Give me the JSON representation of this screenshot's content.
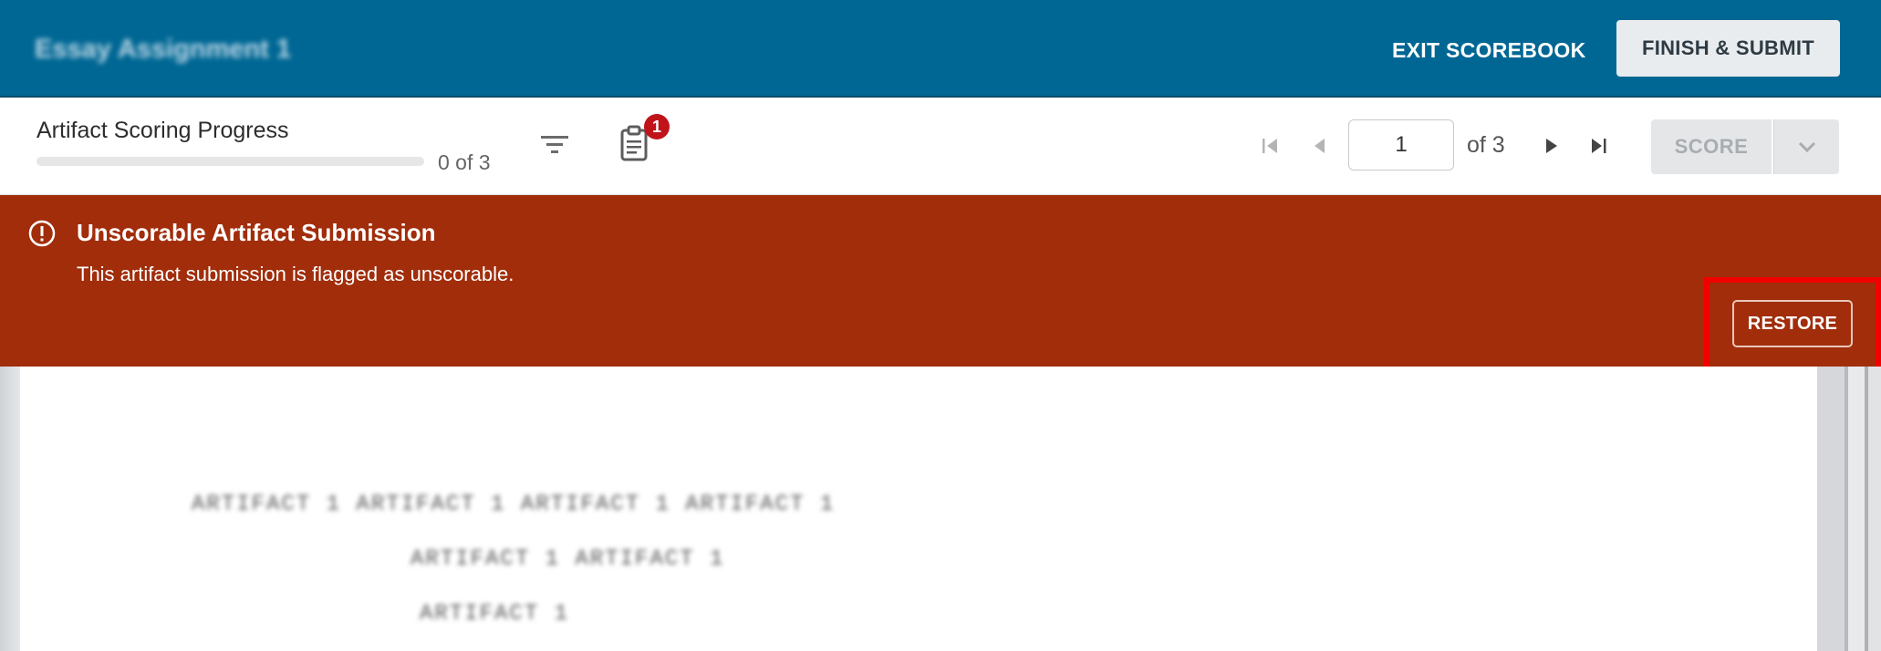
{
  "header": {
    "title": "Essay Assignment 1",
    "exit_label": "EXIT SCOREBOOK",
    "finish_label": "FINISH & SUBMIT"
  },
  "toolbar": {
    "progress_title": "Artifact Scoring Progress",
    "progress_text": "0 of 3",
    "progress_fraction": 0,
    "notification_count": "1",
    "icons": [
      "filter-icon",
      "clipboard-icon",
      "first-page-icon",
      "prev-page-icon",
      "next-page-icon",
      "last-page-icon",
      "chevron-down-icon"
    ],
    "page_value": "1",
    "page_of": "of 3",
    "score_label": "SCORE"
  },
  "alert": {
    "title": "Unscorable Artifact Submission",
    "message": "This artifact submission is flagged as unscorable.",
    "restore_label": "RESTORE",
    "icon": "alert-circle-icon"
  },
  "document": {
    "lines": [
      "ARTIFACT 1   ARTIFACT 1   ARTIFACT 1   ARTIFACT 1",
      "ARTIFACT 1   ARTIFACT 1",
      "ARTIFACT 1"
    ]
  },
  "colors": {
    "header_bg": "#006794",
    "alert_bg": "#a12d0b",
    "highlight": "#f20000"
  }
}
